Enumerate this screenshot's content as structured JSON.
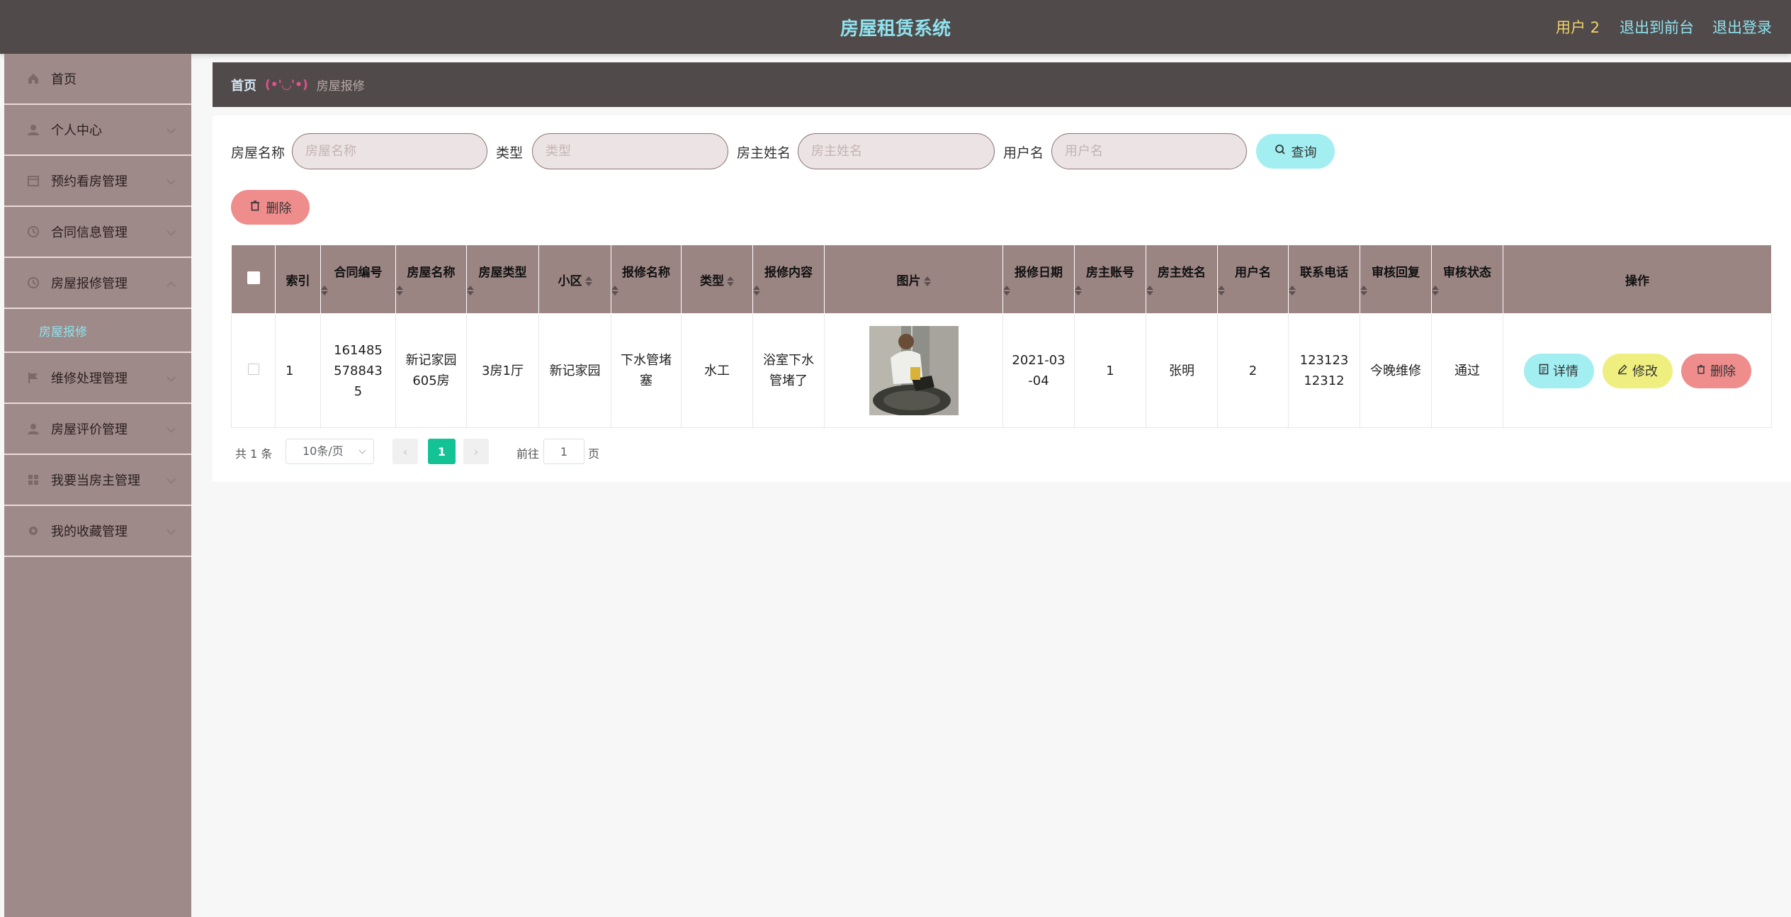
{
  "header": {
    "title": "房屋租赁系统",
    "user": "用户 2",
    "to_front": "退出到前台",
    "logout": "退出登录"
  },
  "sidebar": {
    "items": [
      {
        "label": "首页",
        "icon": "home-icon"
      },
      {
        "label": "个人中心",
        "icon": "user-icon"
      },
      {
        "label": "预约看房管理",
        "icon": "calendar-icon"
      },
      {
        "label": "合同信息管理",
        "icon": "clock-icon"
      },
      {
        "label": "房屋报修管理",
        "icon": "clock-icon",
        "expanded": true
      },
      {
        "label": "维修处理管理",
        "icon": "flag-icon"
      },
      {
        "label": "房屋评价管理",
        "icon": "user-icon"
      },
      {
        "label": "我要当房主管理",
        "icon": "grid-icon"
      },
      {
        "label": "我的收藏管理",
        "icon": "gear-icon"
      }
    ],
    "sub_active": "房屋报修"
  },
  "breadcrumb": {
    "home": "首页",
    "separator": "(•'◡'•)",
    "current": "房屋报修"
  },
  "filters": {
    "house_name_label": "房屋名称",
    "house_name_placeholder": "房屋名称",
    "type_label": "类型",
    "type_placeholder": "类型",
    "owner_name_label": "房主姓名",
    "owner_name_placeholder": "房主姓名",
    "username_label": "用户名",
    "username_placeholder": "用户名",
    "query_button": "查询"
  },
  "bulk_delete": "删除",
  "table": {
    "columns": [
      "索引",
      "合同编号",
      "房屋名称",
      "房屋类型",
      "小区",
      "报修名称",
      "类型",
      "报修内容",
      "图片",
      "报修日期",
      "房主账号",
      "房主姓名",
      "用户名",
      "联系电话",
      "审核回复",
      "审核状态",
      "操作"
    ],
    "rows": [
      {
        "index": "1",
        "contract_no": "1614855788435",
        "house_name": "新记家园605房",
        "house_type": "3房1厅",
        "community": "新记家园",
        "repair_name": "下水管堵塞",
        "type": "水工",
        "repair_content": "浴室下水管堵了",
        "repair_date": "2021-03-04",
        "owner_account": "1",
        "owner_name": "张明",
        "username": "2",
        "phone": "12312312312",
        "review_reply": "今晚维修",
        "review_status": "通过",
        "actions": {
          "detail": "详情",
          "edit": "修改",
          "delete": "删除"
        }
      }
    ]
  },
  "pagination": {
    "total": "共 1 条",
    "page_size": "10条/页",
    "current": "1",
    "goto_label": "前往",
    "goto_value": "1",
    "page_suffix": "页"
  },
  "colors": {
    "header_bg": "#514a4a",
    "sidebar_bg": "#9e8a88",
    "accent_cyan": "#8fe3ee",
    "table_header": "#9a8583",
    "page_active": "#13c295"
  }
}
